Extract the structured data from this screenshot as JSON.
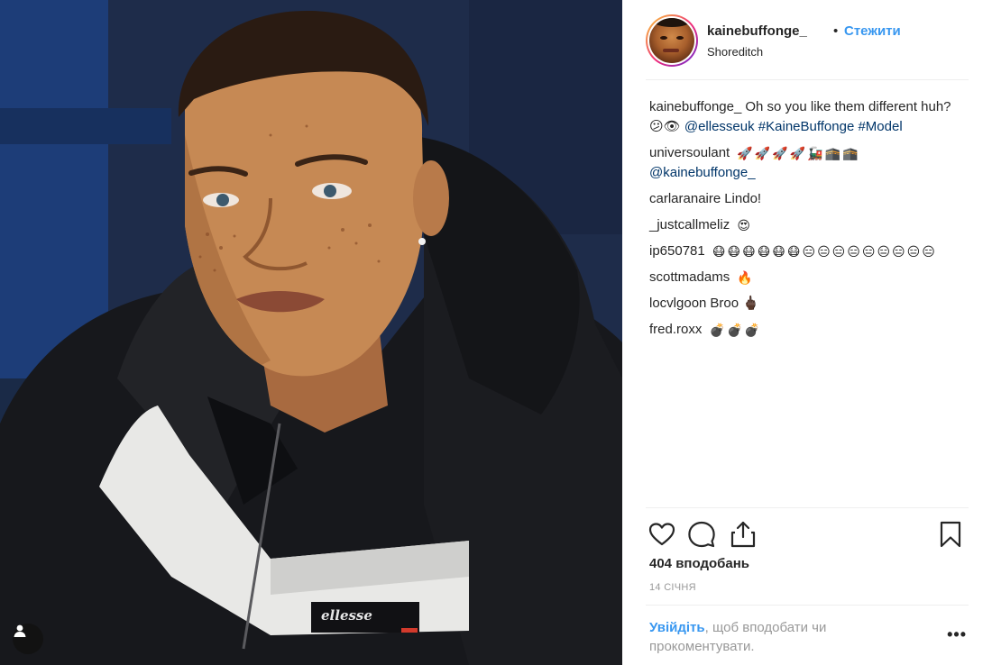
{
  "post": {
    "username": "kainebuffonge_",
    "separator": "•",
    "follow_label": "Стежити",
    "location": "Shoreditch",
    "photo_brand": "ellesse"
  },
  "caption": {
    "username": "kainebuffonge_",
    "text": "Oh so you like them different huh? 😕👁",
    "mention": "@ellesseuk",
    "hashtag1": "#KaineBuffonge",
    "hashtag2": "#Model"
  },
  "comments": [
    {
      "username": "universoulant",
      "text": "🚀🚀🚀🚀🚂🕋🕋",
      "mention": "@kainebuffonge_"
    },
    {
      "username": "carlaranaire",
      "text": "Lindo!"
    },
    {
      "username": "_justcallmeliz",
      "text": "😍"
    },
    {
      "username": "ip650781",
      "text": "😷😷😷😷😷😷😑😑😑😑😑😑😑😑😑"
    },
    {
      "username": "scottmadams",
      "text": "🔥"
    },
    {
      "username": "locvlgoon",
      "text": "Broo 🖕🏿"
    },
    {
      "username": "fred.roxx",
      "text": "💣💣💣"
    }
  ],
  "icons": {
    "like": "heart-outline",
    "comment": "speech-bubble",
    "share": "share-upload",
    "save": "bookmark",
    "tag": "user-silhouette",
    "more": "ellipsis"
  },
  "stats": {
    "likes": "404 вподобань",
    "date": "14 січня"
  },
  "login": {
    "link_label": "Увійдіть",
    "rest": ", щоб вподобати чи прокоментувати."
  },
  "more_label": "•••"
}
